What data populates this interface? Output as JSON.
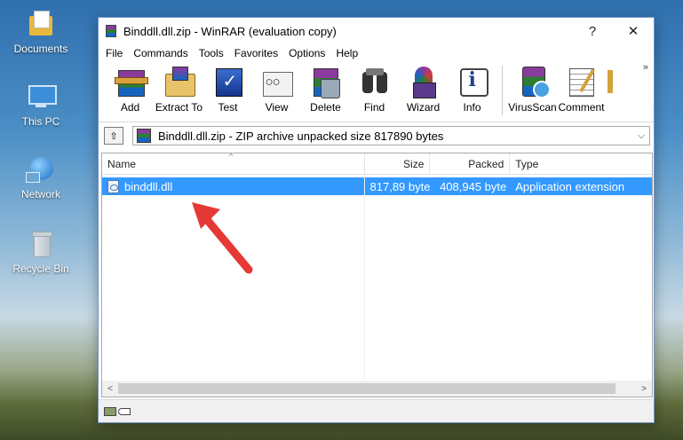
{
  "desktop": {
    "icons": [
      {
        "label": "Documents",
        "icon": "documents-folder-icon"
      },
      {
        "label": "This PC",
        "icon": "computer-icon"
      },
      {
        "label": "Network",
        "icon": "network-globe-icon"
      },
      {
        "label": "Recycle Bin",
        "icon": "recycle-bin-icon"
      }
    ]
  },
  "window": {
    "title": "Binddll.dll.zip - WinRAR (evaluation copy)",
    "help_glyph": "?",
    "close_glyph": "✕"
  },
  "menu": [
    "File",
    "Commands",
    "Tools",
    "Favorites",
    "Options",
    "Help"
  ],
  "toolbar": {
    "buttons": [
      {
        "label": "Add",
        "icon": "add-archive-icon"
      },
      {
        "label": "Extract To",
        "icon": "extract-folder-icon"
      },
      {
        "label": "Test",
        "icon": "test-check-icon"
      },
      {
        "label": "View",
        "icon": "view-glasses-icon"
      },
      {
        "label": "Delete",
        "icon": "delete-trash-icon"
      },
      {
        "label": "Find",
        "icon": "find-binoculars-icon"
      },
      {
        "label": "Wizard",
        "icon": "wizard-hat-icon"
      },
      {
        "label": "Info",
        "icon": "info-icon"
      },
      {
        "label": "VirusScan",
        "icon": "virus-scan-icon"
      },
      {
        "label": "Comment",
        "icon": "comment-notepad-icon"
      }
    ],
    "overflow_glyph": "»"
  },
  "address": {
    "up_glyph": "⇧",
    "path": "Binddll.dll.zip - ZIP archive unpacked size 817890 bytes",
    "dropdown_glyph": "⌵"
  },
  "filelist": {
    "columns": {
      "name": "Name",
      "size": "Size",
      "packed": "Packed",
      "type": "Type"
    },
    "sort_glyph": "^",
    "rows": [
      {
        "name": "binddll.dll",
        "size": "817,89 byte",
        "packed": "408,945 byte",
        "type": "Application extension",
        "selected": true
      }
    ]
  },
  "scroll": {
    "left_glyph": "<",
    "right_glyph": ">"
  },
  "colors": {
    "selection": "#3399ff",
    "annotation_arrow": "#e53935"
  }
}
